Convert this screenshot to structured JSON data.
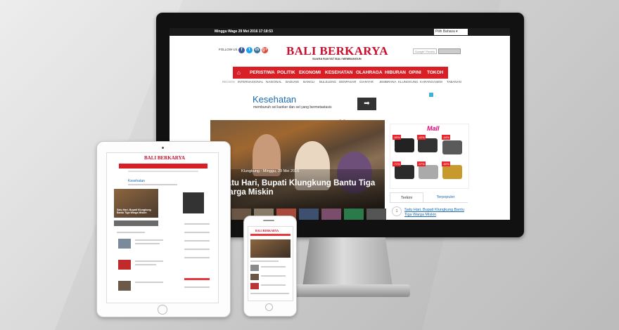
{
  "site": {
    "logo": "BALI BERKARYA",
    "tagline": "SUARA RAKYAT BALI MEMBANGUN",
    "brand_color": "#c8102e",
    "nav_color": "#d91f26",
    "datetime": "Minggu Wage 29 Mei 2016 17:18:53",
    "language_select": "Pilih Bahasa",
    "follow_label": "FOLLOW US :",
    "social": [
      "f",
      "t",
      "in",
      "g+"
    ],
    "search_placeholder": "Google\" Penelu",
    "nav_items": [
      "PERISTIWA",
      "POLITIK",
      "EKONOMI",
      "KESEHATAN",
      "OLAHRAGA",
      "HIBURAN",
      "OPINI",
      "TOKOH"
    ],
    "region_items": [
      "REGION",
      "INTERNASIONAL",
      "NASIONAL",
      "BADUNG",
      "BANGLI",
      "BULELENG",
      "DENPASAR",
      "GIANYAR",
      "JEMBRANA",
      "KLUNGKUNG",
      "KARANGASEM",
      "TABANAN"
    ]
  },
  "ad": {
    "title": "Kesehatan",
    "subtitle": "membunuh sel kanker dan  sel yang bermetastasis",
    "button_icon": "arrow-right-icon"
  },
  "hero": {
    "meta": "Klungkung - Minggu, 29 Mei 2016",
    "headline": "Satu Hari, Bupati Klungkung Bantu Tiga Warga Miskin"
  },
  "side_ad": {
    "brand": "Mall",
    "discounts": [
      "-69%",
      "-42%",
      "-44%",
      "-71%",
      "-57%",
      "-60%"
    ]
  },
  "tabs": [
    "Terkini",
    "Terpopuler"
  ],
  "latest": [
    {
      "num": "1",
      "title": "Satu Hari, Bupati Klungkung Bantu Tiga Warga Miskin"
    }
  ],
  "tablet": {
    "section": "Kesehatan",
    "hero_headline": "Satu Hari, Bupati Klungkung Bantu Tiga Warga Miskin"
  }
}
